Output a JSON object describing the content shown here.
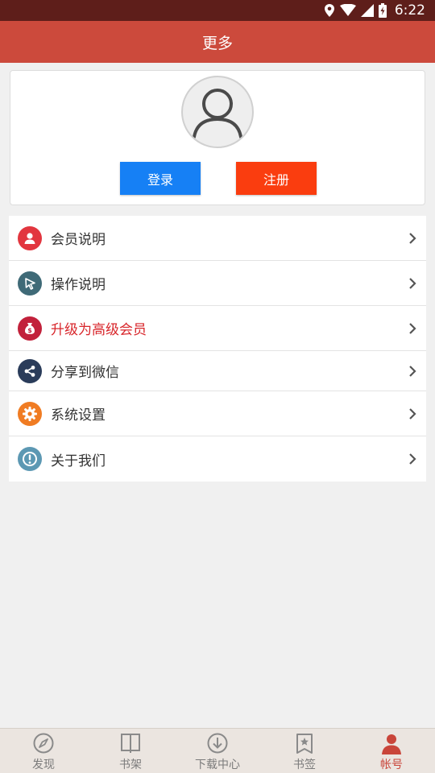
{
  "status_bar": {
    "time": "6:22"
  },
  "app_bar": {
    "title": "更多"
  },
  "profile": {
    "login_label": "登录",
    "register_label": "注册"
  },
  "menu": {
    "items": [
      {
        "label": "会员说明",
        "icon": "member-icon",
        "color": "#e2363f"
      },
      {
        "label": "操作说明",
        "icon": "cursor-icon",
        "color": "#3f6a77"
      },
      {
        "label": "升级为高级会员",
        "icon": "money-bag-icon",
        "color": "#c2213b",
        "highlight": true
      },
      {
        "label": "分享到微信",
        "icon": "share-icon",
        "color": "#2a3c5a"
      },
      {
        "label": "系统设置",
        "icon": "gear-icon",
        "color": "#f07c23"
      },
      {
        "label": "关于我们",
        "icon": "info-icon",
        "color": "#5c98b3"
      }
    ]
  },
  "tab_bar": {
    "tabs": [
      {
        "label": "发现",
        "icon": "compass-icon"
      },
      {
        "label": "书架",
        "icon": "book-icon"
      },
      {
        "label": "下载中心",
        "icon": "download-icon"
      },
      {
        "label": "书签",
        "icon": "bookmark-icon"
      },
      {
        "label": "帐号",
        "icon": "user-icon",
        "active": true
      }
    ]
  },
  "colors": {
    "app_bar": "#cc4a3c",
    "status_bar": "#5e1e1a",
    "login_button": "#1680f5",
    "register_button": "#fa3d0f",
    "highlight_text": "#d8262b",
    "active_tab": "#c9453a"
  }
}
